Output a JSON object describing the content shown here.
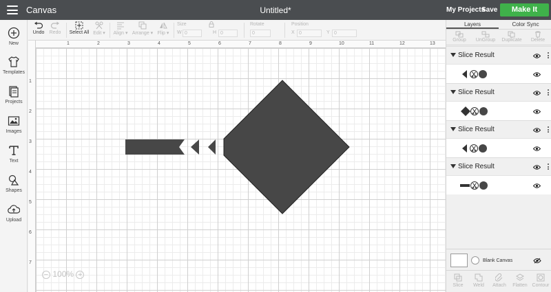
{
  "topbar": {
    "app_title": "Canvas",
    "doc_title": "Untitled*",
    "my_projects": "My Projects",
    "save": "Save",
    "make_it": "Make It",
    "accent": "#3fb24a"
  },
  "sidebar": {
    "items": [
      {
        "label": "New",
        "icon": "plus-circle-icon"
      },
      {
        "label": "Templates",
        "icon": "shirt-icon"
      },
      {
        "label": "Projects",
        "icon": "projects-icon"
      },
      {
        "label": "Images",
        "icon": "image-icon"
      },
      {
        "label": "Text",
        "icon": "text-icon"
      },
      {
        "label": "Shapes",
        "icon": "shapes-icon"
      },
      {
        "label": "Upload",
        "icon": "upload-icon"
      }
    ]
  },
  "toolbar": {
    "undo": "Undo",
    "redo": "Redo",
    "select_all": "Select All",
    "edit": "Edit",
    "align": "Align",
    "arrange": "Arrange",
    "flip": "Flip",
    "size_label": "Size",
    "w_label": "W",
    "w_value": "0",
    "h_label": "H",
    "h_value": "0",
    "rotate_label": "Rotate",
    "rotate_value": "0",
    "position_label": "Position",
    "x_label": "X",
    "x_value": "0",
    "y_label": "Y",
    "y_value": "0"
  },
  "canvas": {
    "ruler_top": [
      "1",
      "2",
      "3",
      "4",
      "5",
      "6",
      "7",
      "8",
      "9",
      "10",
      "11",
      "12",
      "13"
    ],
    "ruler_left": [
      "1",
      "2",
      "3",
      "4",
      "5",
      "6",
      "7"
    ],
    "zoom_minus": "−",
    "zoom_value": "100%",
    "zoom_plus": "+",
    "shape_color": "#474747"
  },
  "panel": {
    "tabs": [
      "Layers",
      "Color Sync"
    ],
    "tools": [
      "Group",
      "UnGroup",
      "Duplicate",
      "Delete"
    ],
    "layers": [
      {
        "name": "Slice Result",
        "thumb": "small-triangle-icon"
      },
      {
        "name": "Slice Result",
        "thumb": "diamond-icon"
      },
      {
        "name": "Slice Result",
        "thumb": "small-triangle-icon"
      },
      {
        "name": "Slice Result",
        "thumb": "bar-icon"
      }
    ],
    "blank_canvas": "Blank Canvas",
    "bottom_tools": [
      "Slice",
      "Weld",
      "Attach",
      "Flatten",
      "Contour"
    ]
  }
}
